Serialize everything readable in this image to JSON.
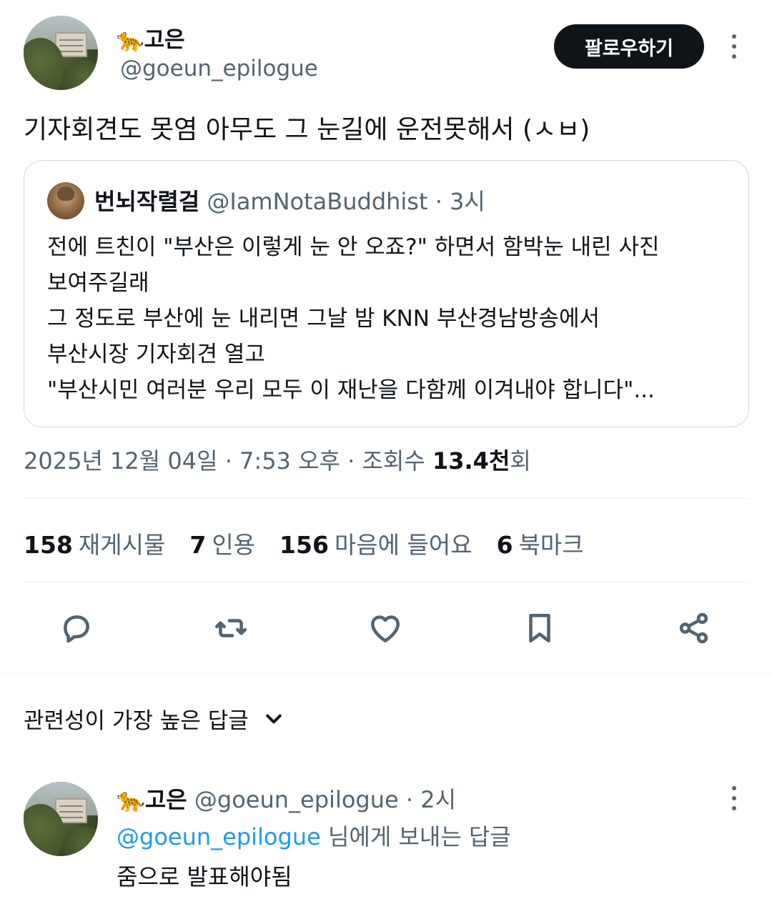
{
  "tweet": {
    "author_name": "🐆고은",
    "author_handle": "@goeun_epilogue",
    "follow_label": "팔로우하기",
    "text": "기자회견도 못염 아무도 그 눈길에 운전못해서 (ㅅㅂ)",
    "timestamp": "2025년 12월 04일 · 7:53 오후 · 조회수 ",
    "views_value": "13.4천",
    "views_suffix": "회"
  },
  "quote": {
    "author_name": "번뇌작렬걸",
    "author_handle": "@IamNotaBuddhist",
    "time": " · 3시",
    "lines": [
      "전에 트친이 \"부산은 이렇게 눈 안 오죠?\" 하면서 함박눈 내린 사진",
      "보여주길래",
      "그 정도로 부산에 눈 내리면 그날 밤 KNN 부산경남방송에서",
      "부산시장 기자회견 열고",
      "\"부산시민 여러분 우리 모두 이 재난을 다함께 이겨내야 합니다\"..."
    ]
  },
  "stats": {
    "reposts_num": "158",
    "reposts_label": "재게시물",
    "quotes_num": "7",
    "quotes_label": "인용",
    "likes_num": "156",
    "likes_label": "마음에 들어요",
    "bookmarks_num": "6",
    "bookmarks_label": "북마크"
  },
  "actions": {
    "icons": [
      "reply-icon",
      "repost-icon",
      "like-icon",
      "bookmark-icon",
      "share-icon"
    ]
  },
  "replies_sort": {
    "label": "관련성이 가장 높은 답글"
  },
  "reply": {
    "author_name": "🐆고은",
    "author_handle": "@goeun_epilogue",
    "time": " · 2시",
    "replying_mention": "@goeun_epilogue",
    "replying_suffix": " 님에게 보내는 답글",
    "text": "줌으로 발표해야됨"
  },
  "colors": {
    "text": "#0f1419",
    "secondary": "#536471",
    "accent": "#1d9bf0",
    "border": "#cfd9de"
  }
}
